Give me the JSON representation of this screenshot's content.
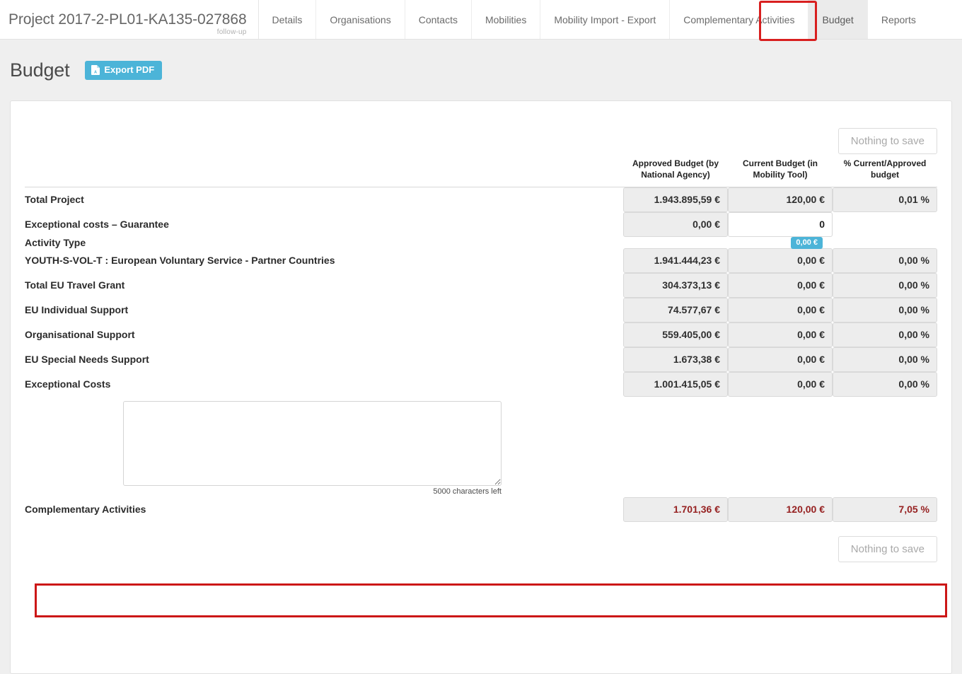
{
  "topnav": {
    "project_title": "Project 2017-2-PL01-KA135-027868",
    "subtitle": "follow-up",
    "tabs": [
      {
        "label": "Details",
        "active": false
      },
      {
        "label": "Organisations",
        "active": false
      },
      {
        "label": "Contacts",
        "active": false
      },
      {
        "label": "Mobilities",
        "active": false
      },
      {
        "label": "Mobility Import - Export",
        "active": false
      },
      {
        "label": "Complementary Activities",
        "active": false
      },
      {
        "label": "Budget",
        "active": true
      },
      {
        "label": "Reports",
        "active": false
      }
    ]
  },
  "pagehead": {
    "title": "Budget",
    "export_label": "Export PDF",
    "export_icon": "pdf-file-icon",
    "export_color": "#4cb4d8"
  },
  "toolbar": {
    "save_label": "Nothing to save",
    "save_label_bottom": "Nothing to save"
  },
  "table": {
    "headers": {
      "label": "",
      "approved": "Approved Budget (by National Agency)",
      "current": "Current Budget (in Mobility Tool)",
      "percent": "% Current/Approved budget"
    },
    "rows": [
      {
        "label": "Total Project",
        "level": 0,
        "approved": "1.943.895,59 €",
        "current": "120,00 €",
        "percent": "0,01 %",
        "editable": false,
        "danger": false,
        "has_percent": true,
        "badge": null
      },
      {
        "label": "Exceptional costs – Guarantee",
        "level": 1,
        "approved": "0,00 €",
        "current": "0",
        "percent": "",
        "editable": true,
        "danger": false,
        "has_percent": false,
        "badge": null
      },
      {
        "label": "Activity Type",
        "level": 1,
        "approved": "",
        "current": "",
        "percent": "",
        "editable": false,
        "danger": false,
        "has_percent": false,
        "is_section": true,
        "badge": null
      },
      {
        "label": "YOUTH-S-VOL-T : European Voluntary Service - Partner Countries",
        "level": 2,
        "approved": "1.941.444,23 €",
        "current": "0,00 €",
        "percent": "0,00 %",
        "editable": false,
        "danger": false,
        "has_percent": true,
        "badge": "0,00 €"
      },
      {
        "label": "Total EU Travel Grant",
        "level": 3,
        "approved": "304.373,13 €",
        "current": "0,00 €",
        "percent": "0,00 %",
        "editable": false,
        "danger": false,
        "has_percent": true,
        "badge": null
      },
      {
        "label": "EU Individual Support",
        "level": 3,
        "approved": "74.577,67 €",
        "current": "0,00 €",
        "percent": "0,00 %",
        "editable": false,
        "danger": false,
        "has_percent": true,
        "badge": null
      },
      {
        "label": "Organisational Support",
        "level": 3,
        "approved": "559.405,00 €",
        "current": "0,00 €",
        "percent": "0,00 %",
        "editable": false,
        "danger": false,
        "has_percent": true,
        "badge": null
      },
      {
        "label": "EU Special Needs Support",
        "level": 3,
        "approved": "1.673,38 €",
        "current": "0,00 €",
        "percent": "0,00 %",
        "editable": false,
        "danger": false,
        "has_percent": true,
        "badge": null
      },
      {
        "label": "Exceptional Costs",
        "level": 3,
        "approved": "1.001.415,05 €",
        "current": "0,00 €",
        "percent": "0,00 %",
        "editable": false,
        "danger": false,
        "has_percent": true,
        "badge": null
      }
    ],
    "comments": {
      "value": "",
      "placeholder": "",
      "counter": "5000 characters left"
    },
    "complementary": {
      "label": "Complementary Activities",
      "level": 1,
      "approved": "1.701,36 €",
      "current": "120,00 €",
      "percent": "7,05 %",
      "danger": true
    }
  },
  "annotations": {
    "budget_tab_highlight_color": "#d81f1f",
    "complementary_row_highlight_color": "#cc1717"
  }
}
